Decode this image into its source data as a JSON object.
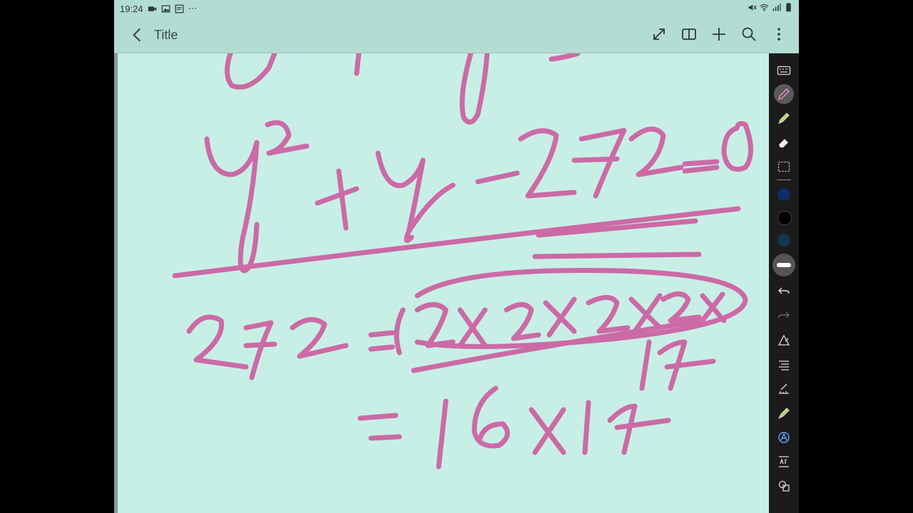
{
  "status": {
    "time": "19:24",
    "more": "⋯"
  },
  "appbar": {
    "title": "Title"
  },
  "toolbar": {
    "swatch_colors": [
      "#0b2e6b",
      "#000000",
      "#12384a"
    ],
    "icons": [
      "keyboard-icon",
      "pen-icon",
      "highlighter-icon",
      "eraser-icon",
      "lasso-select-icon",
      "undo-icon",
      "redo-icon",
      "shape-pen-icon",
      "text-align-icon",
      "ruler-pen-icon",
      "marker-icon",
      "handwriting-icon",
      "text-recognition-icon",
      "shapes-icon"
    ]
  },
  "ink": {
    "color": "#cc6aa6"
  }
}
